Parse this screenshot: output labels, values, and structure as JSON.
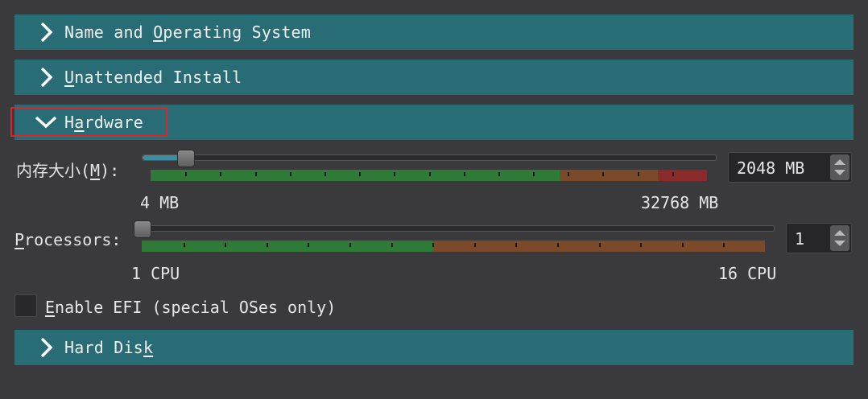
{
  "sections": {
    "name_os": {
      "pre": "Name and ",
      "u": "O",
      "post": "perating System"
    },
    "unattended": {
      "pre": "",
      "u": "U",
      "post": "nattended Install"
    },
    "hardware": {
      "pre": "H",
      "u": "a",
      "post": "rdware"
    },
    "hard_disk": {
      "pre": "Hard Dis",
      "u": "k",
      "post": ""
    }
  },
  "memory": {
    "label_pre": "内存大小(",
    "label_u": "M",
    "label_post": "):",
    "value": "2048 MB",
    "min": "4 MB",
    "max": "32768 MB",
    "level_fraction": 0.0625
  },
  "processors": {
    "label_u": "P",
    "label_post": "rocessors:",
    "value": "1",
    "min": "1 CPU",
    "max": "16 CPU",
    "level_fraction": 0
  },
  "efi": {
    "label_u": "E",
    "label_post": "nable EFI (special OSes only)",
    "checked": false
  },
  "colors": {
    "header": "#286d76",
    "meter_green": "#2e7a36",
    "meter_orange": "#7a4a2a",
    "meter_red": "#8a2a2a",
    "highlight": "#e0232b"
  }
}
